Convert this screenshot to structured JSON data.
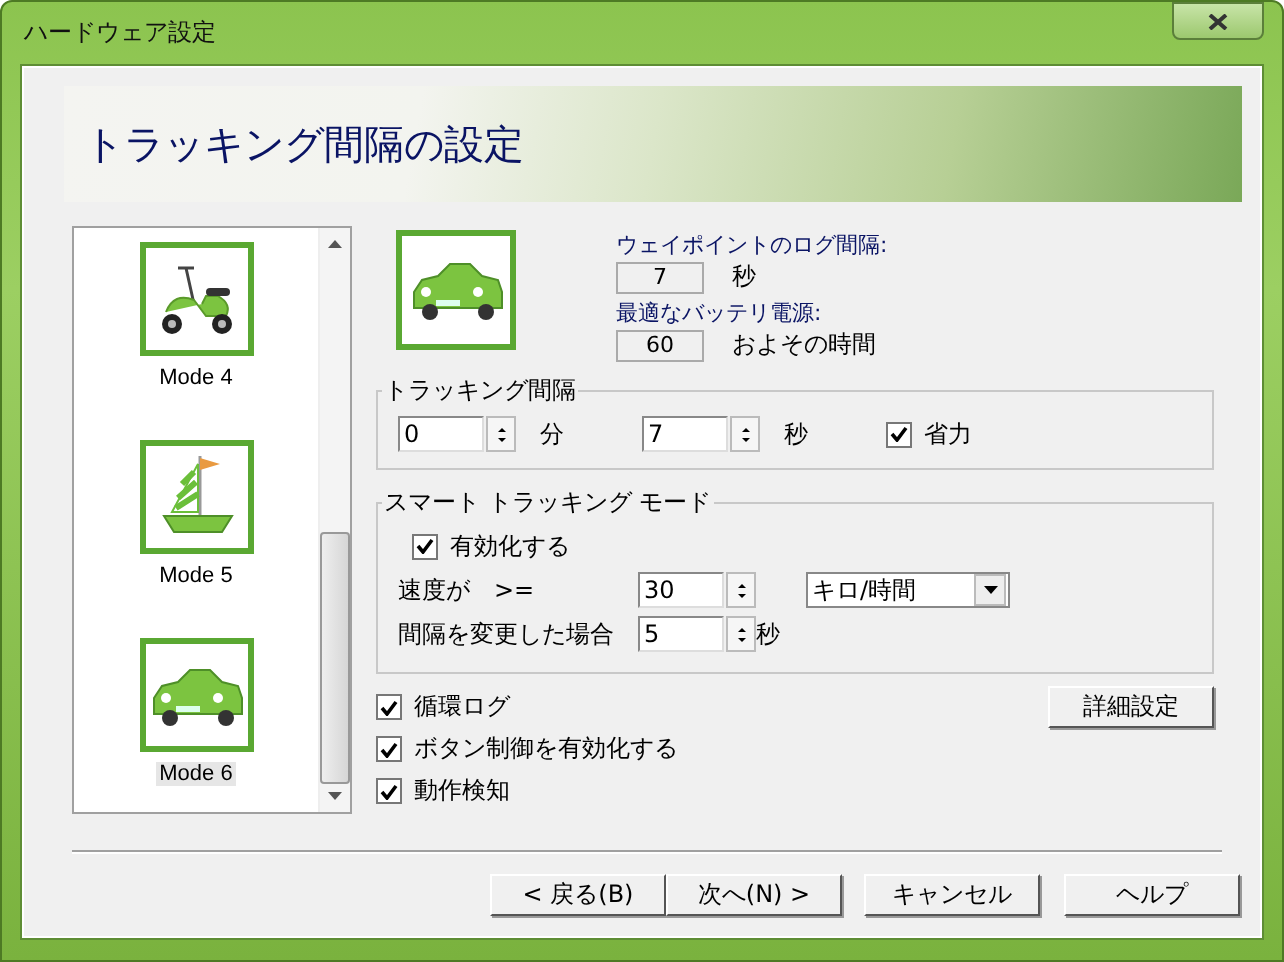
{
  "window": {
    "title": "ハードウェア設定"
  },
  "header": {
    "title": "トラッキング間隔の設定"
  },
  "modes": [
    {
      "label": "Mode 4",
      "kind": "scooter",
      "selected": false
    },
    {
      "label": "Mode 5",
      "kind": "sailboat",
      "selected": false
    },
    {
      "label": "Mode 6",
      "kind": "car",
      "selected": true
    }
  ],
  "info": [
    {
      "label": "ウェイポイントのログ間隔:",
      "value": "7",
      "unit": "秒"
    },
    {
      "label": "最適なバッテリ電源:",
      "value": "60",
      "unit": "およその時間"
    }
  ],
  "tracking_interval": {
    "title": "トラッキング間隔",
    "minutes": {
      "value": "0",
      "unit": "分"
    },
    "seconds": {
      "value": "7",
      "unit": "秒"
    },
    "power_save": {
      "label": "省力",
      "checked": true
    }
  },
  "smart_mode": {
    "title": "スマート トラッキング モード",
    "enable": {
      "label": "有効化する",
      "checked": true
    },
    "speed": {
      "label": "速度が",
      "operator": ">=",
      "value": "30",
      "unit": "キロ/時間"
    },
    "interval": {
      "label": "間隔を変更した場合",
      "value": "5",
      "unit": "秒"
    }
  },
  "options": [
    {
      "label": "循環ログ",
      "checked": true
    },
    {
      "label": "ボタン制御を有効化する",
      "checked": true
    },
    {
      "label": "動作検知",
      "checked": true
    }
  ],
  "advanced_button": "詳細設定",
  "buttons": [
    "< 戻る(B)",
    "次へ(N) >",
    "キャンセル",
    "ヘルプ"
  ]
}
